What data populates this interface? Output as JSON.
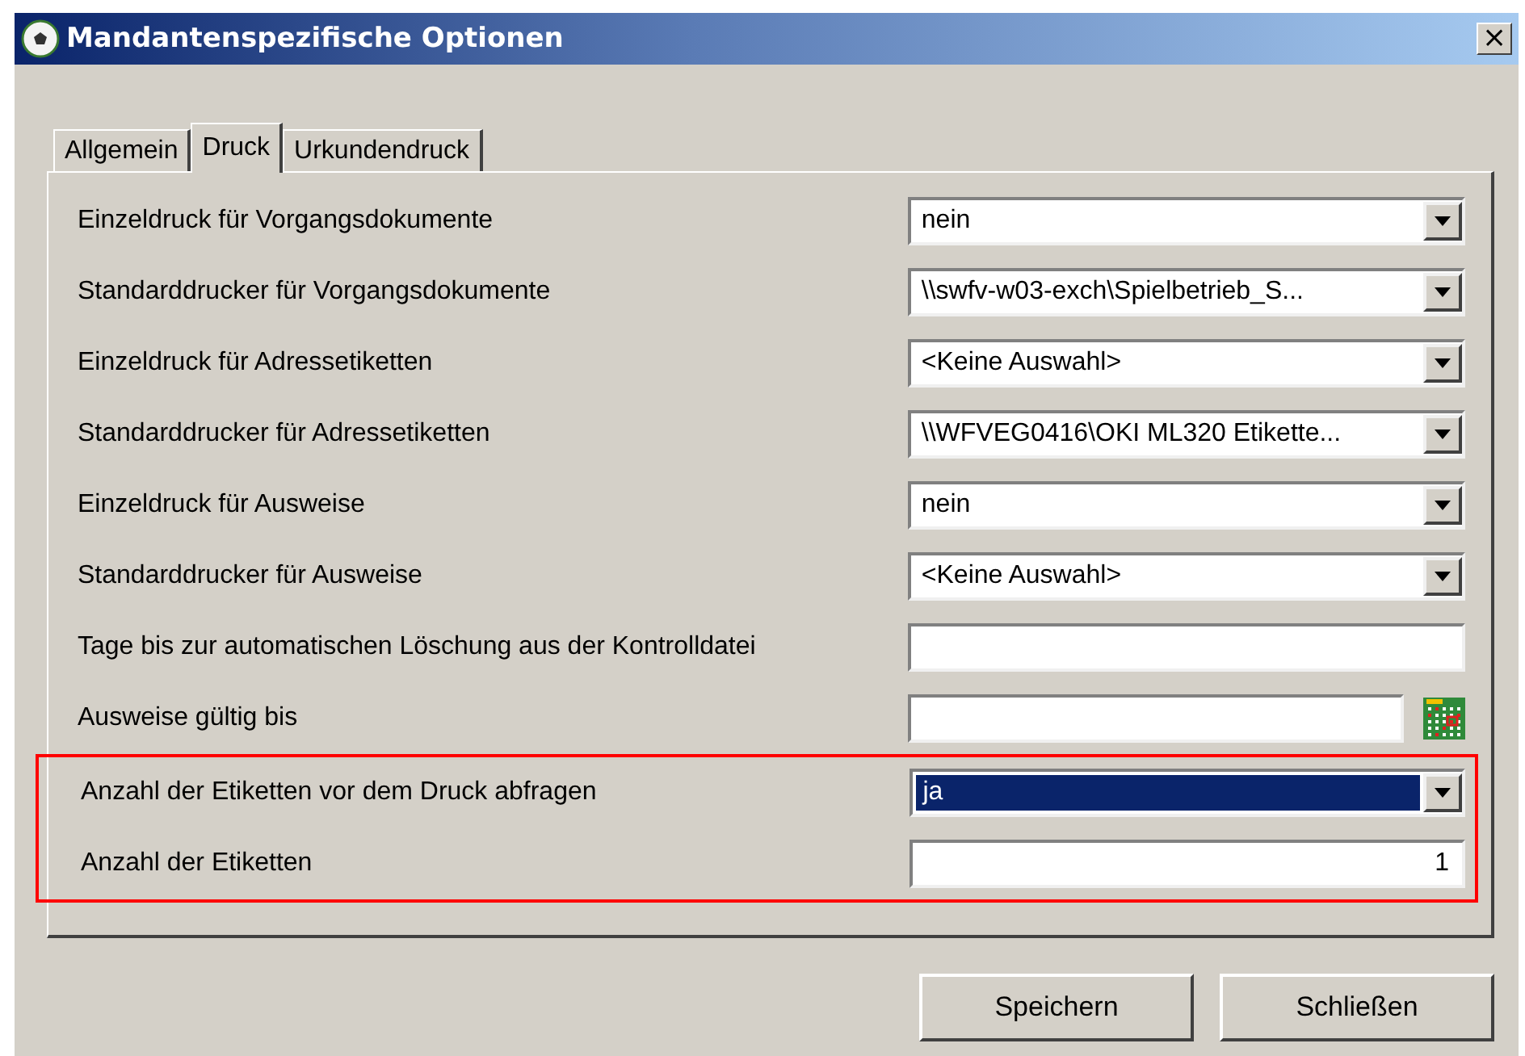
{
  "window": {
    "title": "Mandantenspezifische Optionen",
    "close": "×"
  },
  "tabs": [
    {
      "label": "Allgemein",
      "selected": false
    },
    {
      "label": "Druck",
      "selected": true
    },
    {
      "label": "Urkundendruck",
      "selected": false
    }
  ],
  "sections": [
    {
      "highlighted": false,
      "rows": [
        {
          "label": "Einzeldruck für Vorgangsdokumente",
          "kind": "select",
          "value": "nein",
          "focused": false
        },
        {
          "label": "Standarddrucker für Vorgangsdokumente",
          "kind": "select",
          "value": "\\\\swfv-w03-exch\\Spielbetrieb_S...",
          "focused": false
        },
        {
          "label": "Einzeldruck für Adressetiketten",
          "kind": "select",
          "value": "<Keine Auswahl>",
          "focused": false
        },
        {
          "label": "Standarddrucker für Adressetiketten",
          "kind": "select",
          "value": "\\\\WFVEG0416\\OKI ML320 Etikette...",
          "focused": false
        },
        {
          "label": "Einzeldruck für Ausweise",
          "kind": "select",
          "value": "nein",
          "focused": false
        },
        {
          "label": "Standarddrucker für Ausweise",
          "kind": "select",
          "value": "<Keine Auswahl>",
          "focused": false
        },
        {
          "label": "Tage bis zur automatischen Löschung aus der Kontrolldatei",
          "kind": "text"
        },
        {
          "label": "Ausweise gültig bis",
          "kind": "date"
        }
      ]
    },
    {
      "highlighted": true,
      "rows": [
        {
          "label": "Anzahl der Etiketten vor dem Druck abfragen",
          "kind": "select",
          "value": "ja",
          "focused": true
        },
        {
          "label": "Anzahl der Etiketten",
          "kind": "number",
          "value": "1"
        }
      ]
    }
  ],
  "buttons": [
    "Speichern",
    "Schließen"
  ]
}
